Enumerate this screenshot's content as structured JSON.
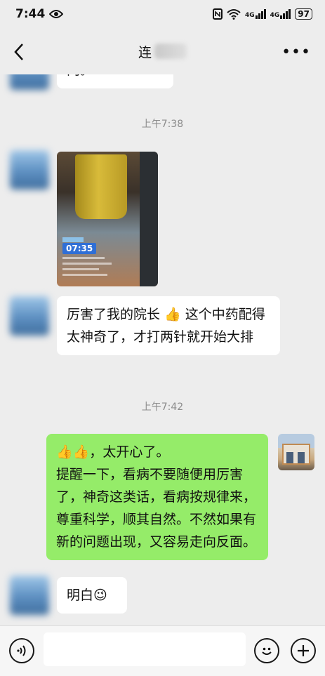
{
  "status_bar": {
    "time": "7:44",
    "signal_1": "4G",
    "signal_2": "4G",
    "battery": "97"
  },
  "header": {
    "title": "连"
  },
  "messages": {
    "top_partial": "门。",
    "time_1": "上午7:38",
    "video_time": "07:35",
    "msg_1": "厉害了我的院长 👍 这个中药配得太神奇了，才打两针就开始大排",
    "time_2": "上午7:42",
    "self_line_1": "👍👍，太开心了。",
    "self_line_2": "提醒一下，看病不要随便用厉害了，神奇这类话，看病按规律来，尊重科学，顺其自然。不然如果有新的问题出现，又容易走向反面。",
    "msg_2": "明白😉"
  },
  "input": {
    "placeholder": ""
  },
  "colors": {
    "background": "#ededed",
    "self_bubble": "#95ec69",
    "other_bubble": "#ffffff"
  },
  "icons": [
    "eye-icon",
    "nfc-icon",
    "wifi-icon",
    "signal-icon",
    "battery-icon",
    "back-arrow-icon",
    "more-icon",
    "voice-icon",
    "emoji-icon",
    "plus-icon"
  ]
}
